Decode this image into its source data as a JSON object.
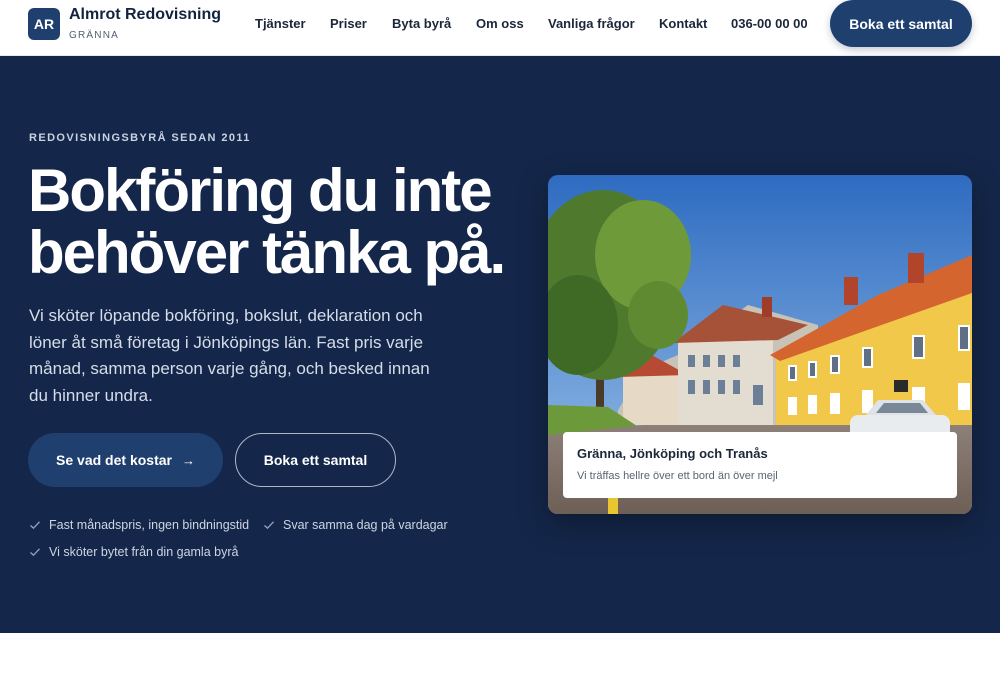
{
  "header": {
    "logo_text": "AR",
    "brand_name": "Almrot Redovisning",
    "brand_city": "GRÄNNA",
    "nav": [
      {
        "label": "Tjänster"
      },
      {
        "label": "Priser"
      },
      {
        "label": "Byta byrå"
      },
      {
        "label": "Om oss"
      },
      {
        "label": "Vanliga frågor"
      },
      {
        "label": "Kontakt"
      }
    ],
    "phone": "036-00 00 00",
    "cta_label": "Boka ett samtal"
  },
  "hero": {
    "eyebrow": "REDOVISNINGSBYRÅ SEDAN 2011",
    "headline_line1": "Bokföring du inte",
    "headline_line2": "behöver tänka på.",
    "lede": "Vi sköter löpande bokföring, bokslut, deklaration och löner åt små företag i Jönköpings län. Fast pris varje månad, samma person varje gång, och besked innan du hinner undra.",
    "primary_label": "Se vad det kostar",
    "primary_arrow": "→",
    "secondary_label": "Boka ett samtal",
    "checks": [
      {
        "label": "Fast månadspris, ingen bindningstid"
      },
      {
        "label": "Svar samma dag på vardagar"
      },
      {
        "label": "Vi sköter bytet från din gamla byrå"
      }
    ],
    "photo_caption": {
      "title": "Gränna, Jönköping och Tranås",
      "subtitle": "Vi träffas hellre över ett bord än över mejl"
    }
  },
  "colors": {
    "brand": "#1f3f6e",
    "hero_background": "#14274a",
    "building_yellow": "#f2c84b",
    "roof_orange": "#d4652e"
  }
}
